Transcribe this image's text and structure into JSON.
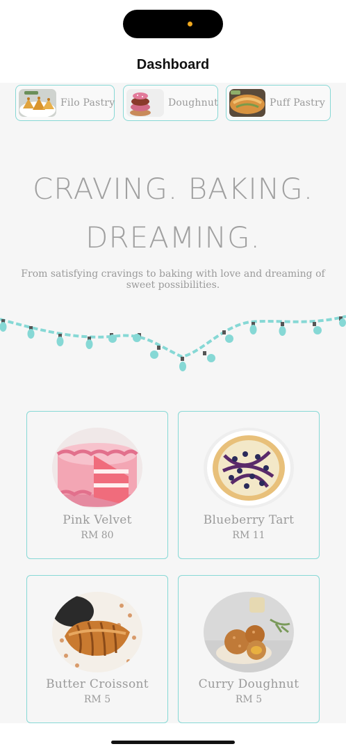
{
  "header": {
    "title": "Dashboard"
  },
  "categories": [
    {
      "label": "Filo Pastry",
      "icon": "filo-pastry-photo"
    },
    {
      "label": "Doughnut",
      "icon": "doughnut-photo"
    },
    {
      "label": "Puff Pastry",
      "icon": "puff-pastry-photo"
    }
  ],
  "hero": {
    "line1": "CRAVING. BAKING.",
    "line2": "DREAMING.",
    "tagline": "From satisfying cravings to baking with love and dreaming of sweet possibilities."
  },
  "products": [
    {
      "name": "Pink Velvet",
      "price": "RM 80",
      "icon": "pink-velvet-cake-photo"
    },
    {
      "name": "Blueberry Tart",
      "price": "RM 11",
      "icon": "blueberry-tart-photo"
    },
    {
      "name": "Butter Croissont",
      "price": "RM 5",
      "icon": "butter-croissant-photo"
    },
    {
      "name": "Curry Doughnut",
      "price": "RM 5",
      "icon": "curry-doughnut-photo"
    }
  ],
  "colors": {
    "accent": "#86d8d5",
    "text": "#9a9a9a",
    "background": "#f6f6f6",
    "indicator": "#f0a81e"
  }
}
